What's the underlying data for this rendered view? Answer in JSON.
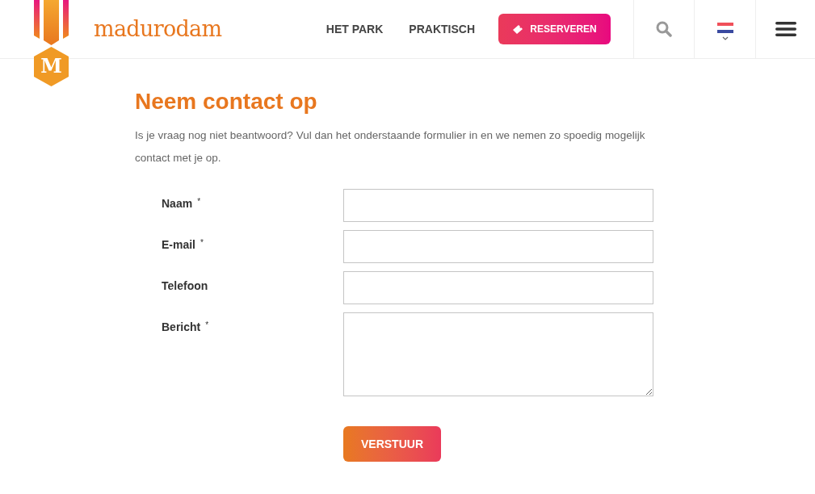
{
  "header": {
    "logo_letter": "M",
    "brand": "madurodam",
    "nav": [
      "HET PARK",
      "PRAKTISCH"
    ],
    "reserve_button": "RESERVEREN"
  },
  "content": {
    "title": "Neem contact op",
    "intro": "Is je vraag nog niet beantwoord? Vul dan het onderstaande formulier in en we nemen zo spoedig mogelijk contact met je op."
  },
  "form": {
    "required_mark": "*",
    "fields": [
      {
        "label": "Naam",
        "required": true,
        "kind": "input"
      },
      {
        "label": "E-mail",
        "required": true,
        "kind": "input"
      },
      {
        "label": "Telefoon",
        "required": false,
        "kind": "input"
      },
      {
        "label": "Bericht",
        "required": true,
        "kind": "textarea"
      }
    ],
    "submit": "VERSTUUR"
  }
}
